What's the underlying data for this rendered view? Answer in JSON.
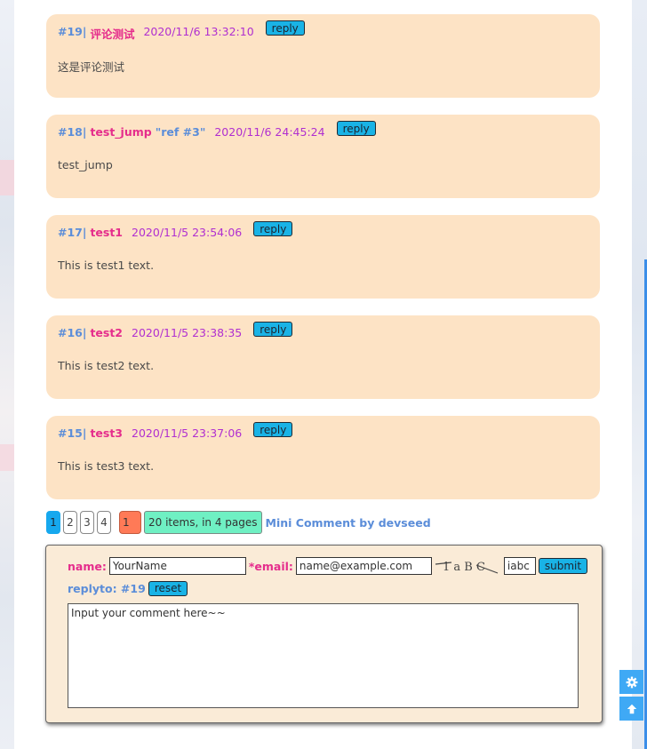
{
  "comments": [
    {
      "id": "#19|",
      "name": "评论测试",
      "ref": "",
      "time": "2020/11/6 13:32:10",
      "reply_label": "reply",
      "text": "这是评论测试"
    },
    {
      "id": "#18|",
      "name": "test_jump",
      "ref": "\"ref #3\"",
      "time": "2020/11/6 24:45:24",
      "reply_label": "reply",
      "text": "test_jump"
    },
    {
      "id": "#17|",
      "name": "test1",
      "ref": "",
      "time": "2020/11/5 23:54:06",
      "reply_label": "reply",
      "text": "This is test1 text."
    },
    {
      "id": "#16|",
      "name": "test2",
      "ref": "",
      "time": "2020/11/5 23:38:35",
      "reply_label": "reply",
      "text": "This is test2 text."
    },
    {
      "id": "#15|",
      "name": "test3",
      "ref": "",
      "time": "2020/11/5 23:37:06",
      "reply_label": "reply",
      "text": "This is test3 text."
    }
  ],
  "pagination": {
    "pages": [
      "1",
      "2",
      "3",
      "4"
    ],
    "current": "1",
    "jump_value": "1",
    "info": "20 items, in 4 pages",
    "credit": "Mini Comment by devseed"
  },
  "form": {
    "name_label": "name:",
    "name_value": "YourName",
    "email_label": "*email:",
    "email_value": "name@example.com",
    "captcha_text": "1 a B C",
    "captcha_input": "iabc",
    "submit_label": "submit",
    "replyto_label": "replyto: #19",
    "reset_label": "reset",
    "comment_placeholder": "Input your comment here~~"
  },
  "colors": {
    "comment_bg": "#fde3c5",
    "form_bg": "#faebd7",
    "button_bg": "#19b3e6",
    "id_color": "#5b8dd9",
    "name_color": "#e52d8c",
    "time_color": "#b02fd0",
    "info_bg": "#6ff0c3",
    "jump_bg": "#ff7a57",
    "float_btn_bg": "#3fa9f5"
  },
  "icons": {
    "settings": "gear-icon",
    "top": "arrow-up-icon"
  }
}
